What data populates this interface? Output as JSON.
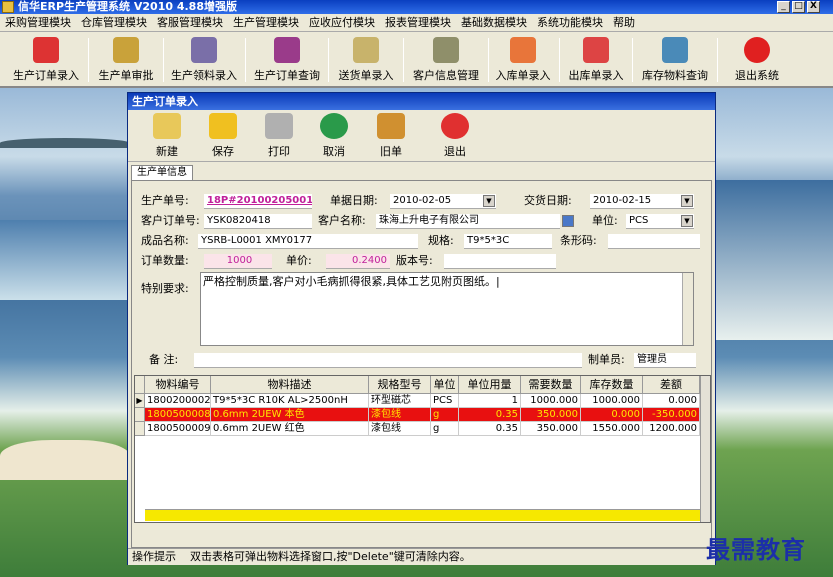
{
  "window": {
    "title": "信华ERP生产管理系统  V2010 4.88增强版",
    "buttons": [
      "_",
      "□",
      "X"
    ]
  },
  "menu": [
    "采购管理模块",
    "仓库管理模块",
    "客服管理模块",
    "生产管理模块",
    "应收应付模块",
    "报表管理模块",
    "基础数据模块",
    "系统功能模块",
    "帮助"
  ],
  "toolbar": [
    {
      "label": "生产订单录入",
      "icon": "pdf-doc-icon",
      "color": "#d33"
    },
    {
      "label": "生产单审批",
      "icon": "approve-icon",
      "color": "#c9a23a"
    },
    {
      "label": "生产领料录入",
      "icon": "material-icon",
      "color": "#7a6fa8"
    },
    {
      "label": "生产订单查询",
      "icon": "query-icon",
      "color": "#9a3b8a"
    },
    {
      "label": "送货单录入",
      "icon": "delivery-icon",
      "color": "#c8b36b"
    },
    {
      "label": "客户信息管理",
      "icon": "customer-icon",
      "color": "#8f8f6a"
    },
    {
      "label": "入库单录入",
      "icon": "flower-icon",
      "color": "#e8753a"
    },
    {
      "label": "出库单录入",
      "icon": "outbound-icon",
      "color": "#d44"
    },
    {
      "label": "库存物料查询",
      "icon": "feather-icon",
      "color": "#4a8ab8"
    },
    {
      "label": "退出系统",
      "icon": "exit-icon",
      "color": "#e02020"
    }
  ],
  "child": {
    "title": "生产订单录入",
    "toolbar": [
      {
        "label": "新建",
        "icon": "clipboard-icon",
        "color": "#e8c85a"
      },
      {
        "label": "保存",
        "icon": "save-icon",
        "color": "#f0c020"
      },
      {
        "label": "打印",
        "icon": "printer-icon",
        "color": "#b0b0b0"
      },
      {
        "label": "取消",
        "icon": "refresh-icon",
        "color": "#2a9a4a"
      },
      {
        "label": "旧单",
        "icon": "old-doc-icon",
        "color": "#d09030"
      },
      {
        "label": "退出",
        "icon": "exit-icon",
        "color": "#e03030"
      }
    ],
    "tab": "生产单信息"
  },
  "form": {
    "order_no_label": "生产单号:",
    "order_no": "18P#20100205001",
    "doc_date_label": "单据日期:",
    "doc_date": "2010-02-05",
    "delivery_date_label": "交货日期:",
    "delivery_date": "2010-02-15",
    "cust_order_label": "客户订单号:",
    "cust_order": "YSK0820418",
    "cust_name_label": "客户名称:",
    "cust_name": "珠海上升电子有限公司",
    "unit_label": "单位:",
    "unit": "PCS",
    "product_label": "成品名称:",
    "product": "YSRB-L0001    XMY0177",
    "spec_label": "规格:",
    "spec": "T9*5*3C",
    "barcode_label": "条形码:",
    "barcode": "",
    "qty_label": "订单数量:",
    "qty": "1000",
    "price_label": "单价:",
    "price": "0.2400",
    "version_label": "版本号:",
    "version": "",
    "special_label": "特别要求:",
    "special": "严格控制质量,客户对小毛病抓得很紧,具体工艺见附页图纸。|",
    "note_label": "备  注:",
    "note": "",
    "maker_label": "制单员:",
    "maker": "管理员"
  },
  "grid": {
    "headers": [
      "物料编号",
      "物料描述",
      "规格型号",
      "单位",
      "单位用量",
      "需要数量",
      "库存数量",
      "差额"
    ],
    "rows": [
      {
        "marker": "▶",
        "cells": [
          "1800200002",
          "T9*5*3C   R10K    AL>2500nH",
          "环型磁芯",
          "PCS",
          "1",
          "1000.000",
          "1000.000",
          "0.000"
        ],
        "highlight": false
      },
      {
        "marker": "",
        "cells": [
          "1800500008",
          "0.6mm  2UEW  本色",
          "漆包线",
          "g",
          "0.35",
          "350.000",
          "0.000",
          "-350.000"
        ],
        "highlight": true
      },
      {
        "marker": "",
        "cells": [
          "1800500009",
          "0.6mm  2UEW  红色",
          "漆包线",
          "g",
          "0.35",
          "350.000",
          "1550.000",
          "1200.000"
        ],
        "highlight": false
      }
    ]
  },
  "status": {
    "label": "操作提示",
    "text": "双击表格可弹出物料选择窗口,按\"Delete\"键可清除内容。"
  },
  "watermark": "最需教育"
}
